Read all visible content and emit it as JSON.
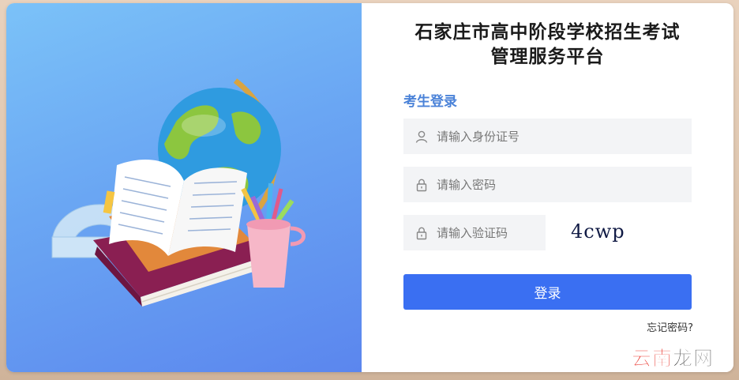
{
  "header": {
    "title_line1": "石家庄市高中阶段学校招生考试",
    "title_line2": "管理服务平台"
  },
  "login": {
    "section_label": "考生登录",
    "id_placeholder": "请输入身份证号",
    "password_placeholder": "请输入密码",
    "captcha_placeholder": "请输入验证码",
    "captcha_text": "4cwp",
    "submit_label": "登录",
    "forgot_label": "忘记密码?"
  },
  "watermark": {
    "part1": "云南",
    "part2": "龙网"
  },
  "colors": {
    "accent": "#3a6ff2",
    "section_label": "#4a82d8",
    "hero_gradient_start": "#7bc2f8",
    "hero_gradient_end": "#5b86ee"
  },
  "icons": {
    "id_field": "user-icon",
    "password_field": "lock-icon",
    "captcha_field": "lock-icon"
  }
}
